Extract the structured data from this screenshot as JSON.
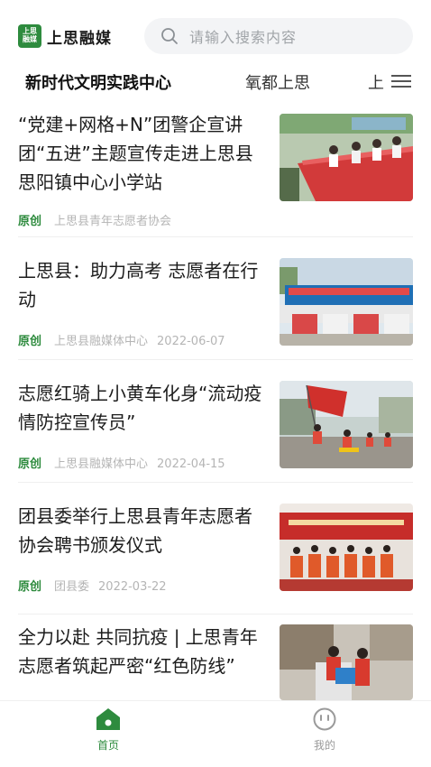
{
  "app": {
    "logo_mark": "上思融媒",
    "logo_text": "上思融媒"
  },
  "search": {
    "placeholder": "请输入搜索内容"
  },
  "tabs": [
    {
      "label": "新时代文明实践中心",
      "active": true
    },
    {
      "label": "氧都上思",
      "active": false
    },
    {
      "label": "上",
      "active": false
    }
  ],
  "articles": [
    {
      "title": "“党建+网格+N”团警企宣讲团“五进”主题宣传走进上思县思阳镇中心小学站",
      "tag": "原创",
      "source": "上思县青年志愿者协会",
      "date": ""
    },
    {
      "title": "上思县：助力高考 志愿者在行动",
      "tag": "原创",
      "source": "上思县融媒体中心",
      "date": "2022-06-07"
    },
    {
      "title": "志愿红骑上小黄车化身“流动疫情防控宣传员”",
      "tag": "原创",
      "source": "上思县融媒体中心",
      "date": "2022-04-15"
    },
    {
      "title": "团县委举行上思县青年志愿者协会聘书颁发仪式",
      "tag": "原创",
      "source": "团县委",
      "date": "2022-03-22"
    },
    {
      "title": "全力以赴 共同抗疫 | 上思青年志愿者筑起严密“红色防线”",
      "tag": "",
      "source": "",
      "date": ""
    }
  ],
  "bottom_nav": {
    "home_label": "首页",
    "mine_label": "我的"
  },
  "colors": {
    "accent": "#2e8b3e",
    "meta_text": "#b5b5b5"
  }
}
